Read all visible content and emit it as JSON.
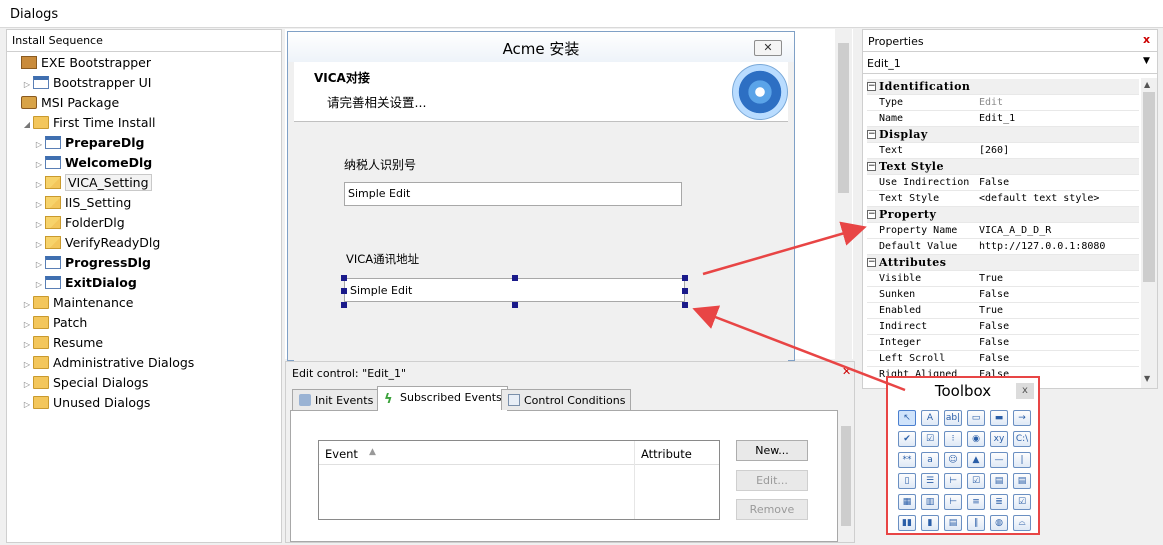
{
  "app": {
    "title": "Dialogs"
  },
  "install_sequence": {
    "header": "Install Sequence",
    "items": [
      {
        "label": "EXE Bootstrapper",
        "level": 0,
        "icon": "bootstrapper-icon",
        "bold": false
      },
      {
        "label": "Bootstrapper UI",
        "level": 1,
        "icon": "dialog-icon",
        "bold": false
      },
      {
        "label": "MSI Package",
        "level": 0,
        "icon": "msi-package-icon",
        "bold": false
      },
      {
        "label": "First Time Install",
        "level": 1,
        "icon": "folder-icon",
        "expanded": true,
        "bold": false
      },
      {
        "label": "PrepareDlg",
        "level": 2,
        "icon": "dialog-icon",
        "bold": true
      },
      {
        "label": "WelcomeDlg",
        "level": 2,
        "icon": "dialog-icon",
        "bold": true
      },
      {
        "label": "VICA_Setting",
        "level": 2,
        "icon": "custom-dialog-icon",
        "bold": false,
        "selected": true
      },
      {
        "label": "IIS_Setting",
        "level": 2,
        "icon": "custom-dialog-icon",
        "bold": false
      },
      {
        "label": "FolderDlg",
        "level": 2,
        "icon": "custom-dialog-icon",
        "bold": false
      },
      {
        "label": "VerifyReadyDlg",
        "level": 2,
        "icon": "custom-dialog-icon",
        "bold": false
      },
      {
        "label": "ProgressDlg",
        "level": 2,
        "icon": "dialog-icon",
        "bold": true
      },
      {
        "label": "ExitDialog",
        "level": 2,
        "icon": "dialog-icon",
        "bold": true
      },
      {
        "label": "Maintenance",
        "level": 1,
        "icon": "folder-icon",
        "bold": false
      },
      {
        "label": "Patch",
        "level": 1,
        "icon": "folder-icon",
        "bold": false
      },
      {
        "label": "Resume",
        "level": 1,
        "icon": "folder-icon",
        "bold": false
      },
      {
        "label": "Administrative Dialogs",
        "level": 1,
        "icon": "folder-icon",
        "bold": false
      },
      {
        "label": "Special Dialogs",
        "level": 1,
        "icon": "folder-icon",
        "bold": false
      },
      {
        "label": "Unused Dialogs",
        "level": 1,
        "icon": "folder-icon",
        "bold": false
      }
    ]
  },
  "dialog_preview": {
    "title": "Acme 安装",
    "close_glyph": "✕",
    "banner_title": "VICA对接",
    "banner_subtitle": "请完善相关设置...",
    "label1": "纳税人识别号",
    "edit1_text": "Simple Edit",
    "label2": "VICA通讯地址",
    "edit2_text": "Simple Edit"
  },
  "edit_panel": {
    "title": "Edit control: \"Edit_1\"",
    "close_glyph": "✕",
    "tabs": [
      {
        "label": "Init Events",
        "active": false
      },
      {
        "label": "Subscribed Events",
        "active": true
      },
      {
        "label": "Control Conditions",
        "active": false
      }
    ],
    "columns": {
      "event": "Event",
      "attribute": "Attribute"
    },
    "buttons": {
      "new": "New...",
      "edit": "Edit...",
      "remove": "Remove"
    }
  },
  "properties": {
    "header": "Properties",
    "close_glyph": "x",
    "selected_control": "Edit_1",
    "rows": [
      {
        "type": "category",
        "name": "Identification"
      },
      {
        "type": "prop",
        "name": "Type",
        "value": "Edit",
        "dim": true
      },
      {
        "type": "prop",
        "name": "Name",
        "value": "Edit_1"
      },
      {
        "type": "category",
        "name": "Display"
      },
      {
        "type": "prop",
        "name": "Text",
        "value": "[260]"
      },
      {
        "type": "category",
        "name": "Text Style"
      },
      {
        "type": "prop",
        "name": "Use Indirection",
        "value": "False"
      },
      {
        "type": "prop",
        "name": "Text Style",
        "value": "<default text style>"
      },
      {
        "type": "category",
        "name": "Property"
      },
      {
        "type": "prop",
        "name": "Property Name",
        "value": "VICA_A_D_D_R"
      },
      {
        "type": "prop",
        "name": "Default Value",
        "value": "http://127.0.0.1:8080"
      },
      {
        "type": "category",
        "name": "Attributes"
      },
      {
        "type": "prop",
        "name": "Visible",
        "value": "True"
      },
      {
        "type": "prop",
        "name": "Sunken",
        "value": "False"
      },
      {
        "type": "prop",
        "name": "Enabled",
        "value": "True"
      },
      {
        "type": "prop",
        "name": "Indirect",
        "value": "False"
      },
      {
        "type": "prop",
        "name": "Integer",
        "value": "False"
      },
      {
        "type": "prop",
        "name": "Left Scroll",
        "value": "False"
      },
      {
        "type": "prop",
        "name": "Right Aligned",
        "value": "False"
      }
    ]
  },
  "toolbox": {
    "title": "Toolbox",
    "close_glyph": "x",
    "tools": [
      {
        "name": "pointer-tool-icon",
        "glyph": "↖"
      },
      {
        "name": "text-tool-icon",
        "glyph": "A"
      },
      {
        "name": "edit-tool-icon",
        "glyph": "ab|"
      },
      {
        "name": "panel-tool-icon",
        "glyph": "▭"
      },
      {
        "name": "button-tool-icon",
        "glyph": "▬"
      },
      {
        "name": "pushbutton-tool-icon",
        "glyph": "→"
      },
      {
        "name": "checkbox-tool-icon",
        "glyph": "✔"
      },
      {
        "name": "checkbox-blue-tool-icon",
        "glyph": "☑"
      },
      {
        "name": "radio-group-tool-icon",
        "glyph": "⁝"
      },
      {
        "name": "radio-tool-icon",
        "glyph": "◉"
      },
      {
        "name": "xy-tool-icon",
        "glyph": "xy"
      },
      {
        "name": "path-tool-icon",
        "glyph": "C:\\"
      },
      {
        "name": "masked-edit-tool-icon",
        "glyph": "**"
      },
      {
        "name": "spin-tool-icon",
        "glyph": "a"
      },
      {
        "name": "emoji-tool-icon",
        "glyph": "☺"
      },
      {
        "name": "image-tool-icon",
        "glyph": "▲"
      },
      {
        "name": "hline-tool-icon",
        "glyph": "—"
      },
      {
        "name": "vline-tool-icon",
        "glyph": "|"
      },
      {
        "name": "group-tool-icon",
        "glyph": "▯"
      },
      {
        "name": "list-tool-icon",
        "glyph": "☰"
      },
      {
        "name": "tree-tool-icon",
        "glyph": "⊢"
      },
      {
        "name": "checklist-tool-icon",
        "glyph": "☑"
      },
      {
        "name": "folder-list-tool-icon",
        "glyph": "▤"
      },
      {
        "name": "dropdown-list-tool-icon",
        "glyph": "▤"
      },
      {
        "name": "folder-tool-icon",
        "glyph": "▦"
      },
      {
        "name": "combo-tool-icon",
        "glyph": "▥"
      },
      {
        "name": "tree-view-tool-icon",
        "glyph": "⊢"
      },
      {
        "name": "listview-tool-icon",
        "glyph": "≡"
      },
      {
        "name": "feature-list-tool-icon",
        "glyph": "≣"
      },
      {
        "name": "checklist2-tool-icon",
        "glyph": "☑"
      },
      {
        "name": "progress-tool-icon",
        "glyph": "▮▮"
      },
      {
        "name": "billboard-tool-icon",
        "glyph": "▮"
      },
      {
        "name": "folder-browse-tool-icon",
        "glyph": "▤"
      },
      {
        "name": "attachment-tool-icon",
        "glyph": "∥"
      },
      {
        "name": "web-tool-icon",
        "glyph": "◍"
      },
      {
        "name": "volume-tool-icon",
        "glyph": "⌓"
      }
    ]
  },
  "colors": {
    "annotation_arrow": "#e84545",
    "selection_handle": "#1a1a8a",
    "props_close": "#cc0000"
  }
}
